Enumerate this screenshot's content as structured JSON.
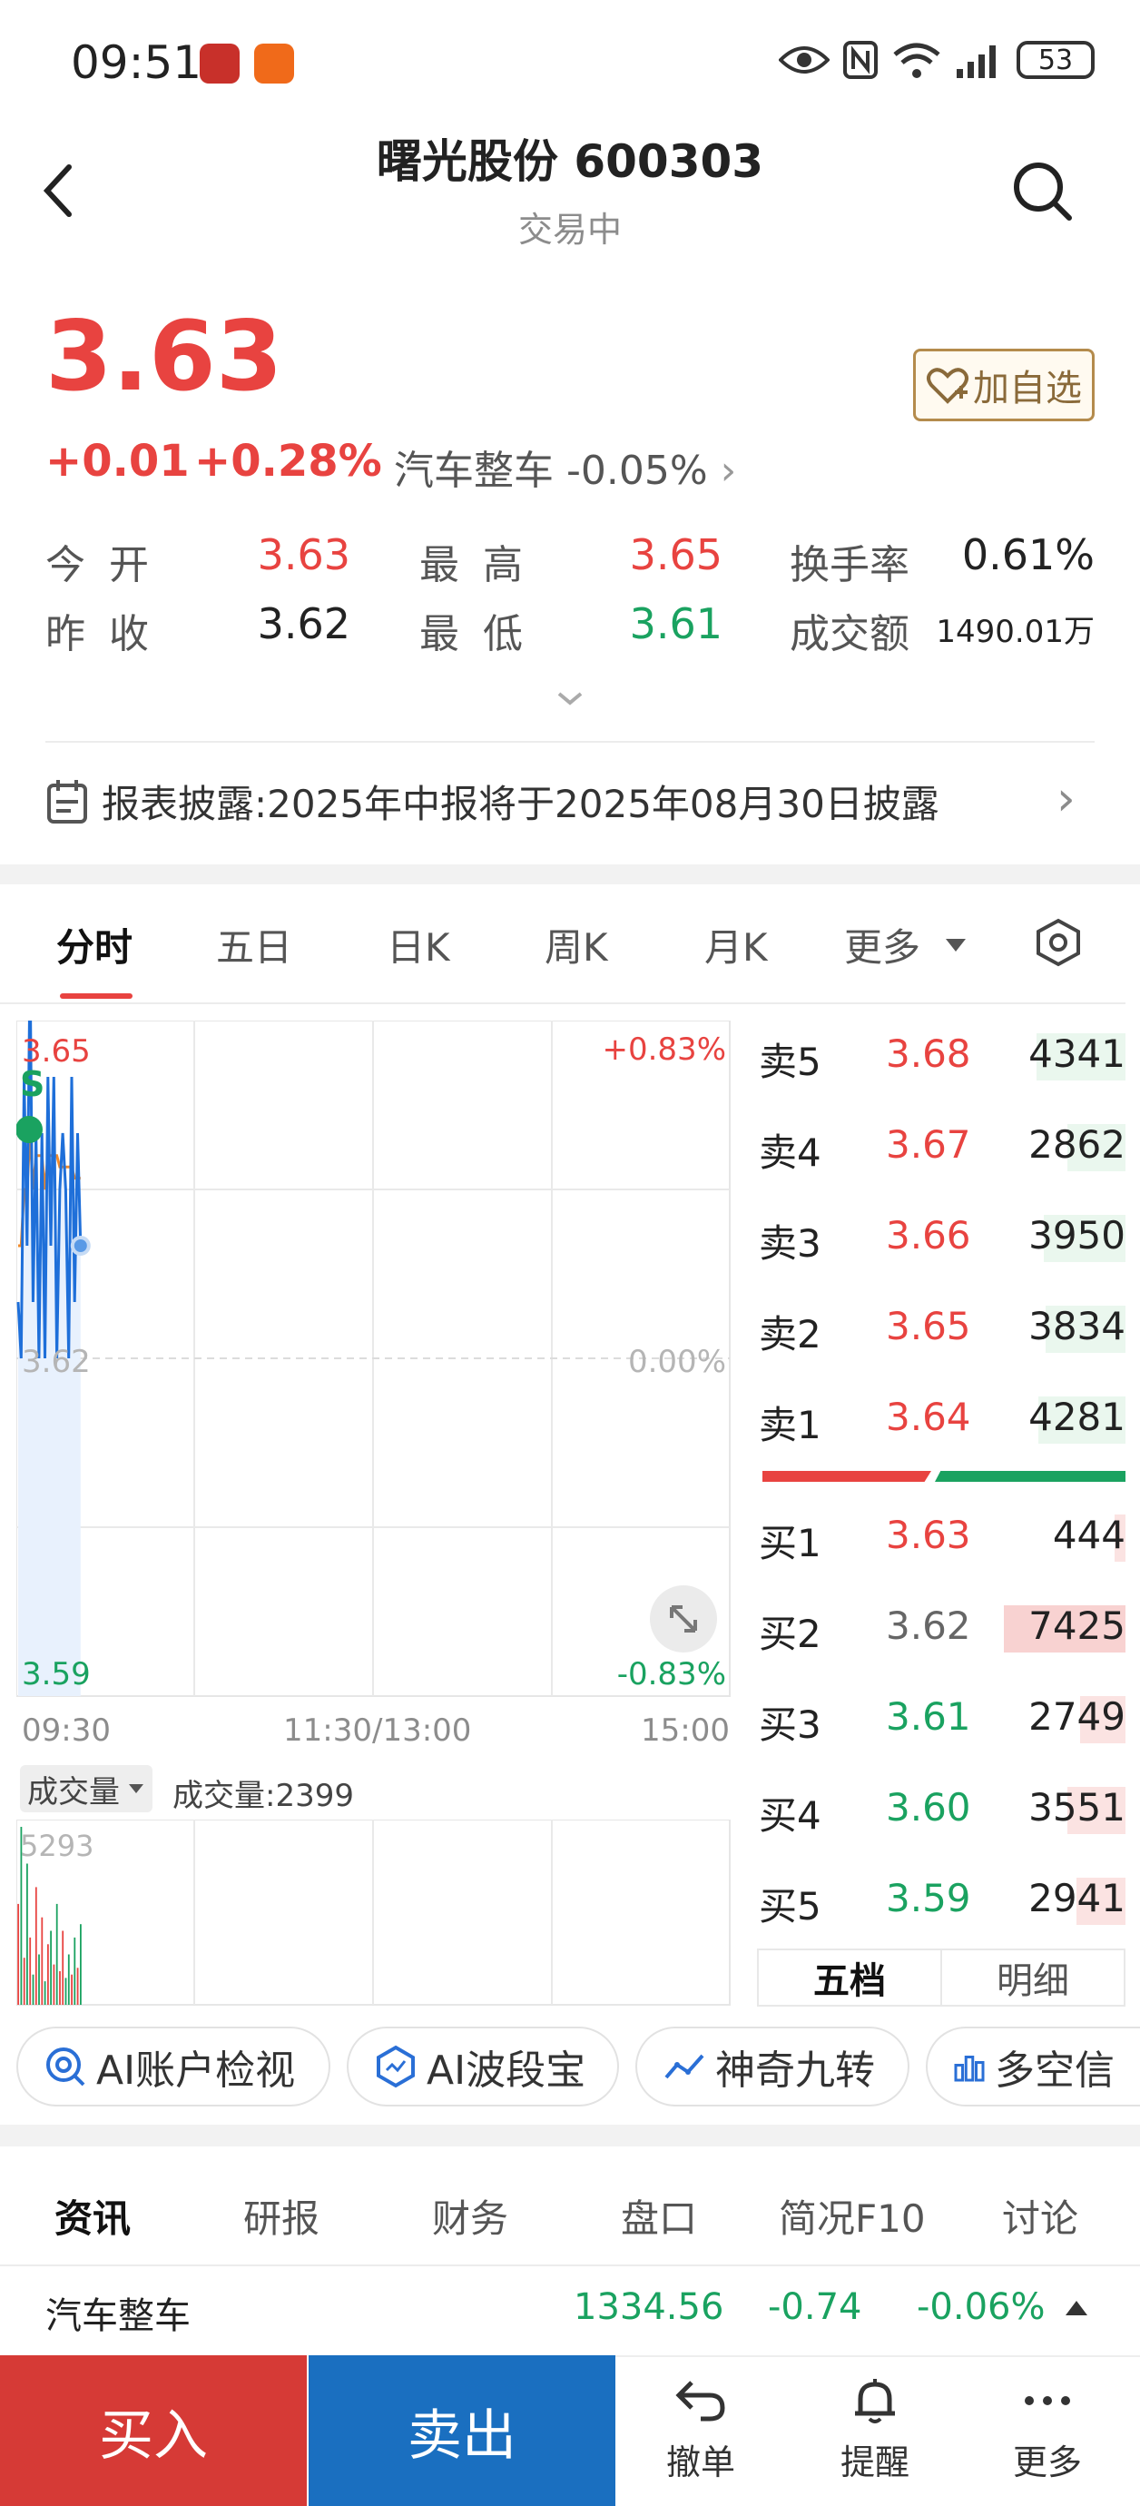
{
  "status_bar": {
    "time": "09:51",
    "battery": "53"
  },
  "header": {
    "title": "曙光股份 600303",
    "subtitle": "交易中"
  },
  "quote": {
    "price": "3.63",
    "change": "+0.01",
    "change_pct": "+0.28%",
    "sector": "汽车整车 -0.05%",
    "add_watchlist": "加自选"
  },
  "stats": {
    "open_label": "今 开",
    "open": "3.63",
    "high_label": "最 高",
    "high": "3.65",
    "turnover_label": "换手率",
    "turnover": "0.61%",
    "prev_label": "昨 收",
    "prev": "3.62",
    "low_label": "最 低",
    "low": "3.61",
    "amount_label": "成交额",
    "amount": "1490.01万"
  },
  "disclosure": "报表披露:2025年中报将于2025年08月30日披露",
  "chart_tabs": [
    "分时",
    "五日",
    "日K",
    "周K",
    "月K",
    "更多"
  ],
  "chart": {
    "top_price": "3.65",
    "top_pct": "+0.83%",
    "mid_price": "3.62",
    "mid_pct": "0.00%",
    "bot_price": "3.59",
    "bot_pct": "-0.83%",
    "t_start": "09:30",
    "t_mid": "11:30/13:00",
    "t_end": "15:00",
    "marker": "S",
    "vol_selector": "成交量",
    "vol_text": "成交量:2399",
    "vol_max": "5293"
  },
  "order_book": {
    "asks": [
      {
        "label": "卖5",
        "price": "3.68",
        "vol": "4341"
      },
      {
        "label": "卖4",
        "price": "3.67",
        "vol": "2862"
      },
      {
        "label": "卖3",
        "price": "3.66",
        "vol": "3950"
      },
      {
        "label": "卖2",
        "price": "3.65",
        "vol": "3834"
      },
      {
        "label": "卖1",
        "price": "3.64",
        "vol": "4281"
      }
    ],
    "bids": [
      {
        "label": "买1",
        "price": "3.63",
        "vol": "444"
      },
      {
        "label": "买2",
        "price": "3.62",
        "vol": "7425"
      },
      {
        "label": "买3",
        "price": "3.61",
        "vol": "2749"
      },
      {
        "label": "买4",
        "price": "3.60",
        "vol": "3551"
      },
      {
        "label": "买5",
        "price": "3.59",
        "vol": "2941"
      }
    ],
    "tab_five": "五档",
    "tab_detail": "明细"
  },
  "ai_tools": [
    "AI账户检视",
    "AI波段宝",
    "神奇九转",
    "多空信"
  ],
  "news_tabs": [
    "资讯",
    "研报",
    "财务",
    "盘口",
    "简况F10",
    "讨论"
  ],
  "sector_row": {
    "name": "汽车整车",
    "value": "1334.56",
    "change": "-0.74",
    "pct": "-0.06%"
  },
  "bottom": {
    "buy": "买入",
    "sell": "卖出",
    "cancel": "撤单",
    "alert": "提醒",
    "more": "更多"
  },
  "colors": {
    "up": "#e84340",
    "down": "#1aa260",
    "buy_bg": "#d63a36",
    "sell_bg": "#1a6fc0",
    "accent": "#b48b4c"
  },
  "chart_data": {
    "type": "line",
    "y_range": [
      3.59,
      3.65
    ],
    "x": [
      "09:30",
      "09:31",
      "09:32",
      "09:33",
      "09:34",
      "09:35",
      "09:36",
      "09:37",
      "09:38",
      "09:39",
      "09:40",
      "09:41",
      "09:42",
      "09:43",
      "09:44",
      "09:45",
      "09:46",
      "09:47",
      "09:48",
      "09:49",
      "09:50",
      "09:51"
    ],
    "series": [
      {
        "values": [
          3.625,
          3.62,
          3.645,
          3.63,
          3.655,
          3.625,
          3.64,
          3.62,
          3.64,
          3.62,
          3.645,
          3.63,
          3.645,
          3.62,
          3.635,
          3.64,
          3.635,
          3.62,
          3.645,
          3.625,
          3.64,
          3.63
        ]
      },
      {
        "values": [
          3.63,
          3.63,
          3.635,
          3.635,
          3.64,
          3.635,
          3.638,
          3.638,
          3.638,
          3.635,
          3.638,
          3.638,
          3.638,
          3.638,
          3.637,
          3.637,
          3.637,
          3.637,
          3.637,
          3.636,
          3.636,
          3.636
        ]
      }
    ],
    "volume": [
      3000,
      5293,
      1400,
      4200,
      2000,
      900,
      3500,
      1500,
      2600,
      700,
      1800,
      2200,
      1200,
      3000,
      1000,
      2200,
      800,
      1500,
      900,
      2000,
      1100,
      2399
    ]
  }
}
